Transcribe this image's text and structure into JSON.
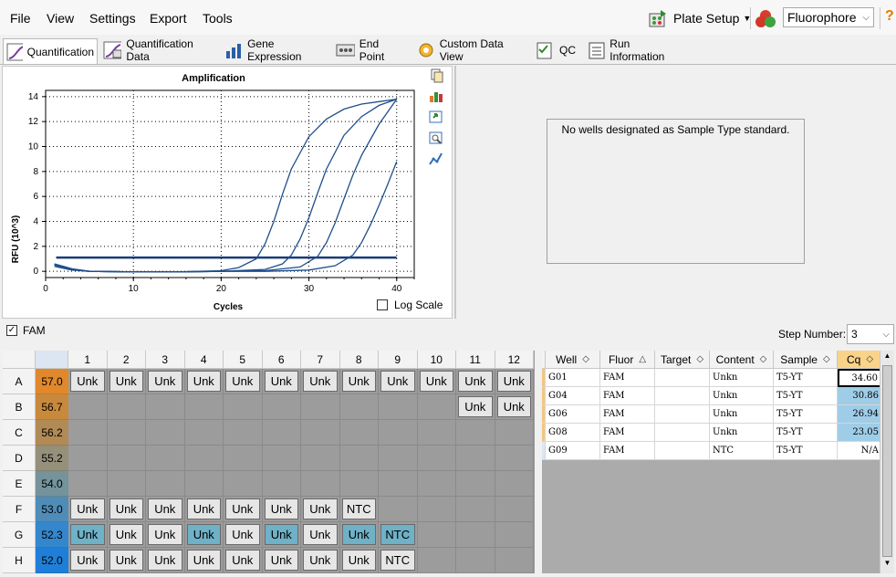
{
  "menu": [
    "File",
    "View",
    "Settings",
    "Export",
    "Tools"
  ],
  "toolbar": {
    "plate_setup": "Plate Setup",
    "fluorophore": "Fluorophore",
    "help": "?"
  },
  "tabs": [
    "Quantification",
    "Quantification Data",
    "Gene Expression",
    "End Point",
    "Custom Data View",
    "QC",
    "Run Information"
  ],
  "std_message": "No wells designated as Sample Type standard.",
  "fam_label": "FAM",
  "log_scale_label": "Log Scale",
  "step_number": {
    "label": "Step Number:",
    "value": "3"
  },
  "colors": {
    "curve": "#1f4e8c",
    "threshold": "#1a3d78",
    "selected_well": "#6fb1c7",
    "plate_bg": "#9c9c9c"
  },
  "chart_data": {
    "type": "line",
    "title": "Amplification",
    "xlabel": "Cycles",
    "ylabel": "RFU (10^3)",
    "xlim": [
      0,
      42
    ],
    "ylim": [
      -0.5,
      14.5
    ],
    "xticks": [
      0,
      10,
      20,
      30,
      40
    ],
    "yticks": [
      0,
      2,
      4,
      6,
      8,
      10,
      12,
      14
    ],
    "grid": true,
    "threshold": 1.1,
    "series": [
      {
        "x": [
          1,
          3,
          5,
          10,
          15,
          20,
          22,
          24,
          25,
          26,
          27,
          28,
          30,
          32,
          34,
          36,
          38,
          40
        ],
        "y": [
          0.6,
          0.2,
          0.0,
          -0.05,
          -0.05,
          0.05,
          0.3,
          1.0,
          2.2,
          4.0,
          6.2,
          8.2,
          10.8,
          12.2,
          13.0,
          13.4,
          13.6,
          13.8
        ]
      },
      {
        "x": [
          1,
          3,
          5,
          10,
          15,
          20,
          25,
          27,
          28,
          29,
          30,
          31,
          32,
          34,
          36,
          38,
          40
        ],
        "y": [
          0.5,
          0.15,
          0.0,
          -0.05,
          -0.05,
          0.0,
          0.15,
          0.6,
          1.3,
          2.6,
          4.3,
          6.3,
          8.2,
          10.9,
          12.4,
          13.3,
          13.8
        ]
      },
      {
        "x": [
          1,
          3,
          5,
          10,
          15,
          20,
          25,
          29,
          31,
          32,
          33,
          34,
          35,
          36,
          38,
          40
        ],
        "y": [
          0.5,
          0.15,
          0.0,
          -0.05,
          -0.05,
          0.0,
          0.05,
          0.35,
          1.2,
          2.3,
          3.9,
          5.8,
          7.7,
          9.3,
          11.8,
          13.8
        ]
      },
      {
        "x": [
          1,
          3,
          5,
          10,
          15,
          20,
          25,
          30,
          33,
          35,
          36,
          37,
          38,
          39,
          40
        ],
        "y": [
          0.4,
          0.1,
          0.0,
          -0.05,
          -0.05,
          0.0,
          0.0,
          0.1,
          0.45,
          1.3,
          2.3,
          3.7,
          5.3,
          7.0,
          8.8
        ]
      }
    ]
  },
  "plate": {
    "columns": [
      "1",
      "2",
      "3",
      "4",
      "5",
      "6",
      "7",
      "8",
      "9",
      "10",
      "11",
      "12"
    ],
    "rows": [
      {
        "label": "A",
        "temp": "57.0",
        "color": "#e0882b",
        "wells": [
          "Unk",
          "Unk",
          "Unk",
          "Unk",
          "Unk",
          "Unk",
          "Unk",
          "Unk",
          "Unk",
          "Unk",
          "Unk",
          "Unk"
        ]
      },
      {
        "label": "B",
        "temp": "56.7",
        "color": "#c9893d",
        "wells": [
          "",
          "",
          "",
          "",
          "",
          "",
          "",
          "",
          "",
          "",
          "Unk",
          "Unk"
        ]
      },
      {
        "label": "C",
        "temp": "56.2",
        "color": "#b18a56",
        "wells": [
          "",
          "",
          "",
          "",
          "",
          "",
          "",
          "",
          "",
          "",
          "",
          ""
        ]
      },
      {
        "label": "D",
        "temp": "55.2",
        "color": "#94907a",
        "wells": [
          "",
          "",
          "",
          "",
          "",
          "",
          "",
          "",
          "",
          "",
          "",
          ""
        ]
      },
      {
        "label": "E",
        "temp": "54.0",
        "color": "#74939b",
        "wells": [
          "",
          "",
          "",
          "",
          "",
          "",
          "",
          "",
          "",
          "",
          "",
          ""
        ]
      },
      {
        "label": "F",
        "temp": "53.0",
        "color": "#4f8cb8",
        "wells": [
          "Unk",
          "Unk",
          "Unk",
          "Unk",
          "Unk",
          "Unk",
          "Unk",
          "NTC",
          "",
          "",
          "",
          ""
        ]
      },
      {
        "label": "G",
        "temp": "52.3",
        "color": "#3487cc",
        "wells": [
          "Unk",
          "Unk",
          "Unk",
          "Unk",
          "Unk",
          "Unk",
          "Unk",
          "Unk",
          "NTC",
          "",
          "",
          ""
        ],
        "selected": [
          0,
          3,
          5,
          7,
          8
        ]
      },
      {
        "label": "H",
        "temp": "52.0",
        "color": "#1f7fd8",
        "wells": [
          "Unk",
          "Unk",
          "Unk",
          "Unk",
          "Unk",
          "Unk",
          "Unk",
          "Unk",
          "NTC",
          "",
          "",
          ""
        ]
      }
    ]
  },
  "results": {
    "headers": [
      "Well",
      "Fluor",
      "Target",
      "Content",
      "Sample",
      "Cq"
    ],
    "rows": [
      {
        "well": "G01",
        "fluor": "FAM",
        "target": "",
        "content": "Unkn",
        "sample": "T5-YT",
        "cq": "34.60"
      },
      {
        "well": "G04",
        "fluor": "FAM",
        "target": "",
        "content": "Unkn",
        "sample": "T5-YT",
        "cq": "30.86"
      },
      {
        "well": "G06",
        "fluor": "FAM",
        "target": "",
        "content": "Unkn",
        "sample": "T5-YT",
        "cq": "26.94"
      },
      {
        "well": "G08",
        "fluor": "FAM",
        "target": "",
        "content": "Unkn",
        "sample": "T5-YT",
        "cq": "23.05"
      },
      {
        "well": "G09",
        "fluor": "FAM",
        "target": "",
        "content": "NTC",
        "sample": "T5-YT",
        "cq": "N/A"
      }
    ]
  }
}
